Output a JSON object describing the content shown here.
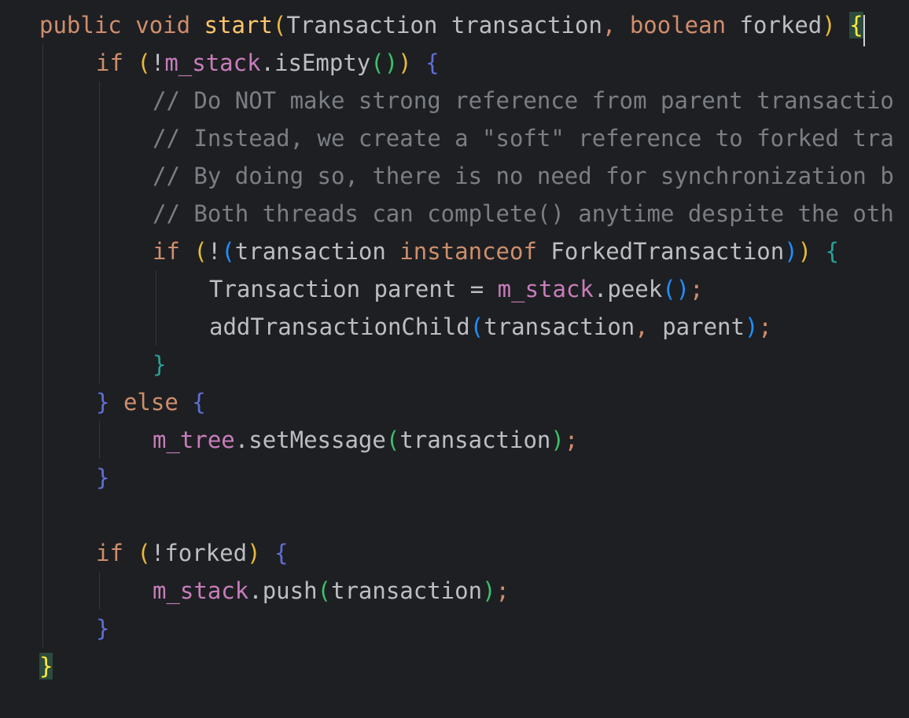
{
  "colors": {
    "background": "#1e1f22",
    "keyword": "#cf8e6d",
    "text": "#bcbec4",
    "field": "#c77dbb",
    "method": "#56a8f5",
    "method_decl": "#ffc66d",
    "comment": "#7a7e85",
    "paren_gold": "#e8b93a",
    "paren_green": "#3dc06c",
    "paren_blue": "#1e90ff",
    "brace_indigo": "#5f6fd6",
    "brace_teal": "#2aa198",
    "brace_yellow": "#ffeb3b",
    "type": "#bcbec4",
    "guide": "#34363a",
    "match_brace_bg": "#2d4a3e"
  },
  "lines": [
    {
      "indent": 0,
      "tokens": [
        {
          "t": "public",
          "c": "keyword"
        },
        {
          "t": " ",
          "c": "text"
        },
        {
          "t": "void",
          "c": "keyword"
        },
        {
          "t": " ",
          "c": "text"
        },
        {
          "t": "start",
          "c": "method_decl"
        },
        {
          "t": "(",
          "c": "paren_gold"
        },
        {
          "t": "Transaction",
          "c": "type"
        },
        {
          "t": " transaction",
          "c": "text"
        },
        {
          "t": ", ",
          "c": "keyword"
        },
        {
          "t": "boolean",
          "c": "keyword"
        },
        {
          "t": " forked",
          "c": "text"
        },
        {
          "t": ")",
          "c": "paren_gold"
        },
        {
          "t": " ",
          "c": "text"
        },
        {
          "t": "{",
          "c": "brace_yellow",
          "hl": true
        }
      ]
    },
    {
      "indent": 1,
      "tokens": [
        {
          "t": "if",
          "c": "keyword"
        },
        {
          "t": " ",
          "c": "text"
        },
        {
          "t": "(",
          "c": "paren_gold"
        },
        {
          "t": "!",
          "c": "text"
        },
        {
          "t": "m_stack",
          "c": "field"
        },
        {
          "t": ".",
          "c": "text"
        },
        {
          "t": "isEmpty",
          "c": "text"
        },
        {
          "t": "()",
          "c": "paren_green"
        },
        {
          "t": ")",
          "c": "paren_gold"
        },
        {
          "t": " ",
          "c": "text"
        },
        {
          "t": "{",
          "c": "brace_indigo"
        }
      ]
    },
    {
      "indent": 2,
      "tokens": [
        {
          "t": "// Do NOT make strong reference from parent transactio",
          "c": "comment"
        }
      ]
    },
    {
      "indent": 2,
      "tokens": [
        {
          "t": "// Instead, we create a \"soft\" reference to forked tra",
          "c": "comment"
        }
      ]
    },
    {
      "indent": 2,
      "tokens": [
        {
          "t": "// By doing so, there is no need for synchronization b",
          "c": "comment"
        }
      ]
    },
    {
      "indent": 2,
      "tokens": [
        {
          "t": "// Both threads can complete() anytime despite the oth",
          "c": "comment"
        }
      ]
    },
    {
      "indent": 2,
      "tokens": [
        {
          "t": "if",
          "c": "keyword"
        },
        {
          "t": " ",
          "c": "text"
        },
        {
          "t": "(",
          "c": "paren_gold"
        },
        {
          "t": "!",
          "c": "text"
        },
        {
          "t": "(",
          "c": "paren_blue"
        },
        {
          "t": "transaction ",
          "c": "text"
        },
        {
          "t": "instanceof",
          "c": "keyword"
        },
        {
          "t": " ForkedTransaction",
          "c": "text"
        },
        {
          "t": ")",
          "c": "paren_blue"
        },
        {
          "t": ")",
          "c": "paren_gold"
        },
        {
          "t": " ",
          "c": "text"
        },
        {
          "t": "{",
          "c": "brace_teal"
        }
      ]
    },
    {
      "indent": 3,
      "tokens": [
        {
          "t": "Transaction",
          "c": "type"
        },
        {
          "t": " parent = ",
          "c": "text"
        },
        {
          "t": "m_stack",
          "c": "field"
        },
        {
          "t": ".",
          "c": "text"
        },
        {
          "t": "peek",
          "c": "text"
        },
        {
          "t": "()",
          "c": "paren_blue"
        },
        {
          "t": ";",
          "c": "keyword"
        }
      ]
    },
    {
      "indent": 3,
      "tokens": [
        {
          "t": "addTransactionChild",
          "c": "text"
        },
        {
          "t": "(",
          "c": "paren_blue"
        },
        {
          "t": "transaction",
          "c": "text"
        },
        {
          "t": ", ",
          "c": "keyword"
        },
        {
          "t": "parent",
          "c": "text"
        },
        {
          "t": ")",
          "c": "paren_blue"
        },
        {
          "t": ";",
          "c": "keyword"
        }
      ]
    },
    {
      "indent": 2,
      "tokens": [
        {
          "t": "}",
          "c": "brace_teal"
        }
      ]
    },
    {
      "indent": 1,
      "tokens": [
        {
          "t": "}",
          "c": "brace_indigo"
        },
        {
          "t": " ",
          "c": "text"
        },
        {
          "t": "else",
          "c": "keyword"
        },
        {
          "t": " ",
          "c": "text"
        },
        {
          "t": "{",
          "c": "brace_indigo"
        }
      ]
    },
    {
      "indent": 2,
      "tokens": [
        {
          "t": "m_tree",
          "c": "field"
        },
        {
          "t": ".",
          "c": "text"
        },
        {
          "t": "setMessage",
          "c": "text"
        },
        {
          "t": "(",
          "c": "paren_green"
        },
        {
          "t": "transaction",
          "c": "text"
        },
        {
          "t": ")",
          "c": "paren_green"
        },
        {
          "t": ";",
          "c": "keyword"
        }
      ]
    },
    {
      "indent": 1,
      "tokens": [
        {
          "t": "}",
          "c": "brace_indigo"
        }
      ]
    },
    {
      "indent": 0,
      "tokens": []
    },
    {
      "indent": 1,
      "tokens": [
        {
          "t": "if",
          "c": "keyword"
        },
        {
          "t": " ",
          "c": "text"
        },
        {
          "t": "(",
          "c": "paren_gold"
        },
        {
          "t": "!forked",
          "c": "text"
        },
        {
          "t": ")",
          "c": "paren_gold"
        },
        {
          "t": " ",
          "c": "text"
        },
        {
          "t": "{",
          "c": "brace_indigo"
        }
      ]
    },
    {
      "indent": 2,
      "tokens": [
        {
          "t": "m_stack",
          "c": "field"
        },
        {
          "t": ".",
          "c": "text"
        },
        {
          "t": "push",
          "c": "text"
        },
        {
          "t": "(",
          "c": "paren_green"
        },
        {
          "t": "transaction",
          "c": "text"
        },
        {
          "t": ")",
          "c": "paren_green"
        },
        {
          "t": ";",
          "c": "keyword"
        }
      ]
    },
    {
      "indent": 1,
      "tokens": [
        {
          "t": "}",
          "c": "brace_indigo"
        }
      ]
    },
    {
      "indent": 0,
      "tokens": [
        {
          "t": "}",
          "c": "brace_yellow",
          "hl": true
        }
      ]
    }
  ]
}
